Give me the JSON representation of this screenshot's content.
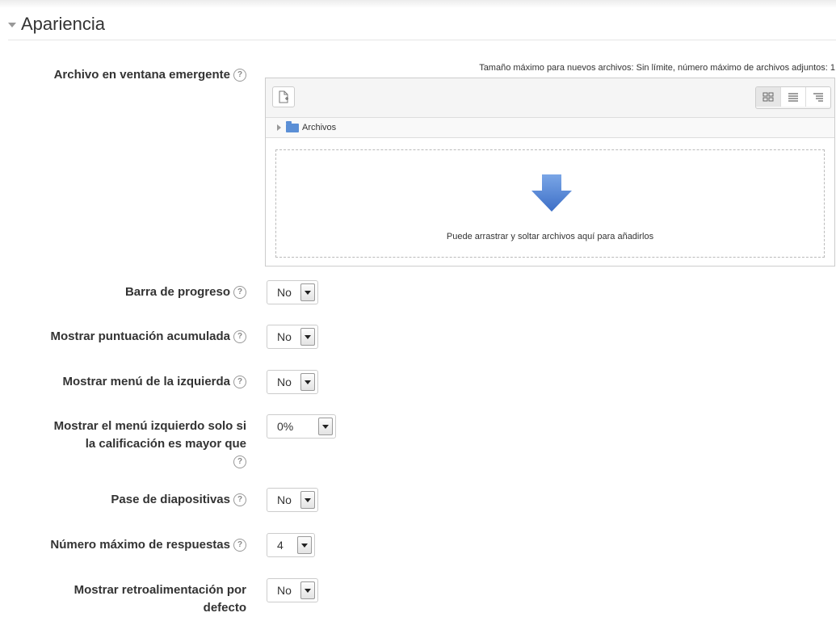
{
  "section": {
    "title": "Apariencia"
  },
  "filepicker": {
    "label": "Archivo en ventana emergente",
    "max_info": "Tamaño máximo para nuevos archivos: Sin límite, número máximo de archivos adjuntos: 1",
    "path_folder": "Archivos",
    "drop_text": "Puede arrastrar y soltar archivos aquí para añadirlos"
  },
  "fields": {
    "progress_bar": {
      "label": "Barra de progreso",
      "value": "No"
    },
    "show_score": {
      "label": "Mostrar puntuación acumulada",
      "value": "No"
    },
    "left_menu": {
      "label": "Mostrar menú de la izquierda",
      "value": "No"
    },
    "left_menu_grade": {
      "label_line1": "Mostrar el menú izquierdo solo si",
      "label_line2": "la calificación es mayor que",
      "value": "0%"
    },
    "slideshow": {
      "label": "Pase de diapositivas",
      "value": "No"
    },
    "max_answers": {
      "label": "Número máximo de respuestas",
      "value": "4"
    },
    "default_feedback": {
      "label_line1": "Mostrar retroalimentación por",
      "label_line2": "defecto",
      "value": "No"
    }
  },
  "help_glyph": "?",
  "colors": {
    "accent": "#5b8fd6"
  }
}
